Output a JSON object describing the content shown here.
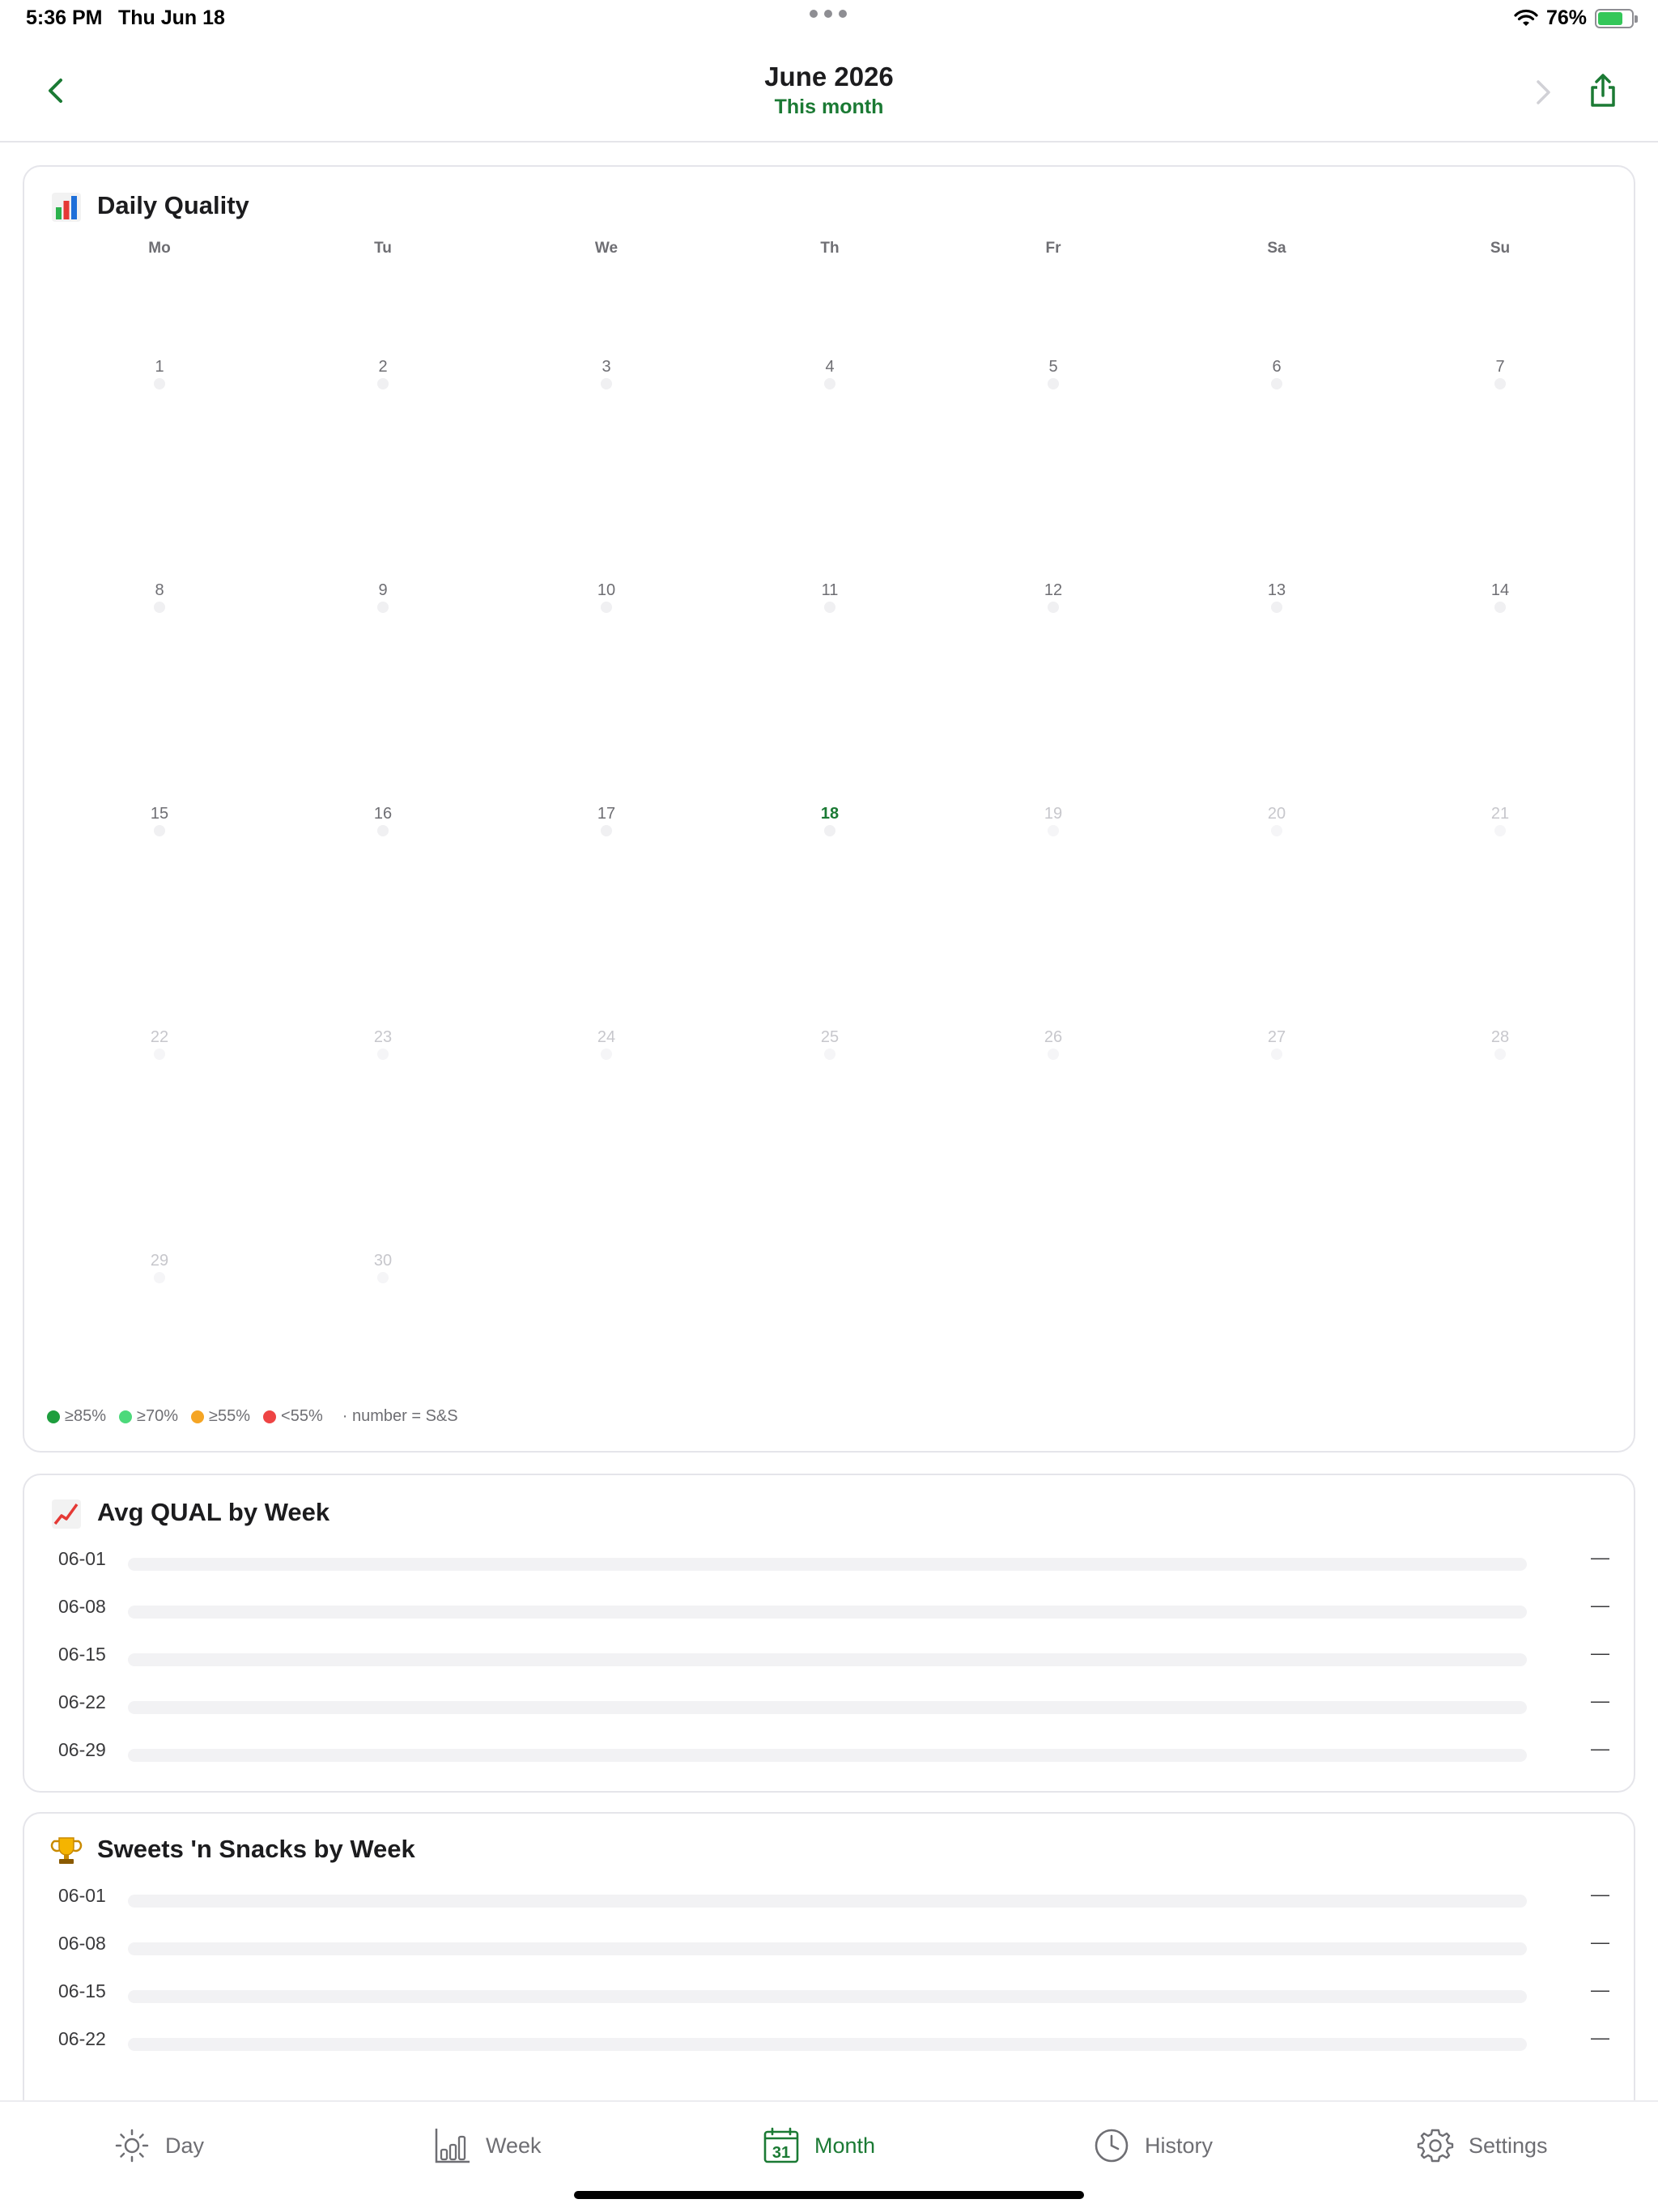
{
  "status_bar": {
    "time": "5:36 PM",
    "date": "Thu Jun 18",
    "battery": "76%",
    "battery_level": 0.76
  },
  "nav": {
    "title": "June 2026",
    "subtitle": "This month"
  },
  "daily_quality": {
    "title": "Daily Quality",
    "icon": "bar-chart-emoji",
    "weekdays": [
      "Mo",
      "Tu",
      "We",
      "Th",
      "Fr",
      "Sa",
      "Su"
    ],
    "today": "18",
    "days": [
      {
        "label": "1"
      },
      {
        "label": "2"
      },
      {
        "label": "3"
      },
      {
        "label": "4"
      },
      {
        "label": "5"
      },
      {
        "label": "6"
      },
      {
        "label": "7"
      },
      {
        "label": "8"
      },
      {
        "label": "9"
      },
      {
        "label": "10"
      },
      {
        "label": "11"
      },
      {
        "label": "12"
      },
      {
        "label": "13"
      },
      {
        "label": "14"
      },
      {
        "label": "15"
      },
      {
        "label": "16"
      },
      {
        "label": "17"
      },
      {
        "label": "18"
      },
      {
        "label": "19"
      },
      {
        "label": "20"
      },
      {
        "label": "21"
      },
      {
        "label": "22"
      },
      {
        "label": "23"
      },
      {
        "label": "24"
      },
      {
        "label": "25"
      },
      {
        "label": "26"
      },
      {
        "label": "27"
      },
      {
        "label": "28"
      },
      {
        "label": "29"
      },
      {
        "label": "30"
      }
    ],
    "legend": [
      {
        "label": "≥85%",
        "color": "#1e9e3e"
      },
      {
        "label": "≥70%",
        "color": "#4cd97b"
      },
      {
        "label": "≥55%",
        "color": "#f5a524"
      },
      {
        "label": "<55%",
        "color": "#ee4444"
      }
    ],
    "legend_note": "· number = S&S"
  },
  "avg_qual": {
    "title": "Avg QUAL by Week",
    "icon": "chart-increasing-emoji",
    "rows": [
      {
        "label": "06-01",
        "value": "—"
      },
      {
        "label": "06-08",
        "value": "—"
      },
      {
        "label": "06-15",
        "value": "—"
      },
      {
        "label": "06-22",
        "value": "—"
      },
      {
        "label": "06-29",
        "value": "—"
      }
    ]
  },
  "sweets_snacks": {
    "title": "Sweets 'n Snacks by Week",
    "icon": "trophy-emoji",
    "rows": [
      {
        "label": "06-01",
        "value": "—"
      },
      {
        "label": "06-08",
        "value": "—"
      },
      {
        "label": "06-15",
        "value": "—"
      },
      {
        "label": "06-22",
        "value": "—"
      }
    ]
  },
  "tabs": [
    {
      "label": "Day",
      "icon": "sun-icon",
      "active": false
    },
    {
      "label": "Week",
      "icon": "bar-chart-icon",
      "active": false
    },
    {
      "label": "Month",
      "icon": "calendar-icon",
      "active": true,
      "icon_text": "31"
    },
    {
      "label": "History",
      "icon": "clock-icon",
      "active": false
    },
    {
      "label": "Settings",
      "icon": "gear-icon",
      "active": false
    }
  ],
  "colors": {
    "accent": "#1b7a34"
  }
}
